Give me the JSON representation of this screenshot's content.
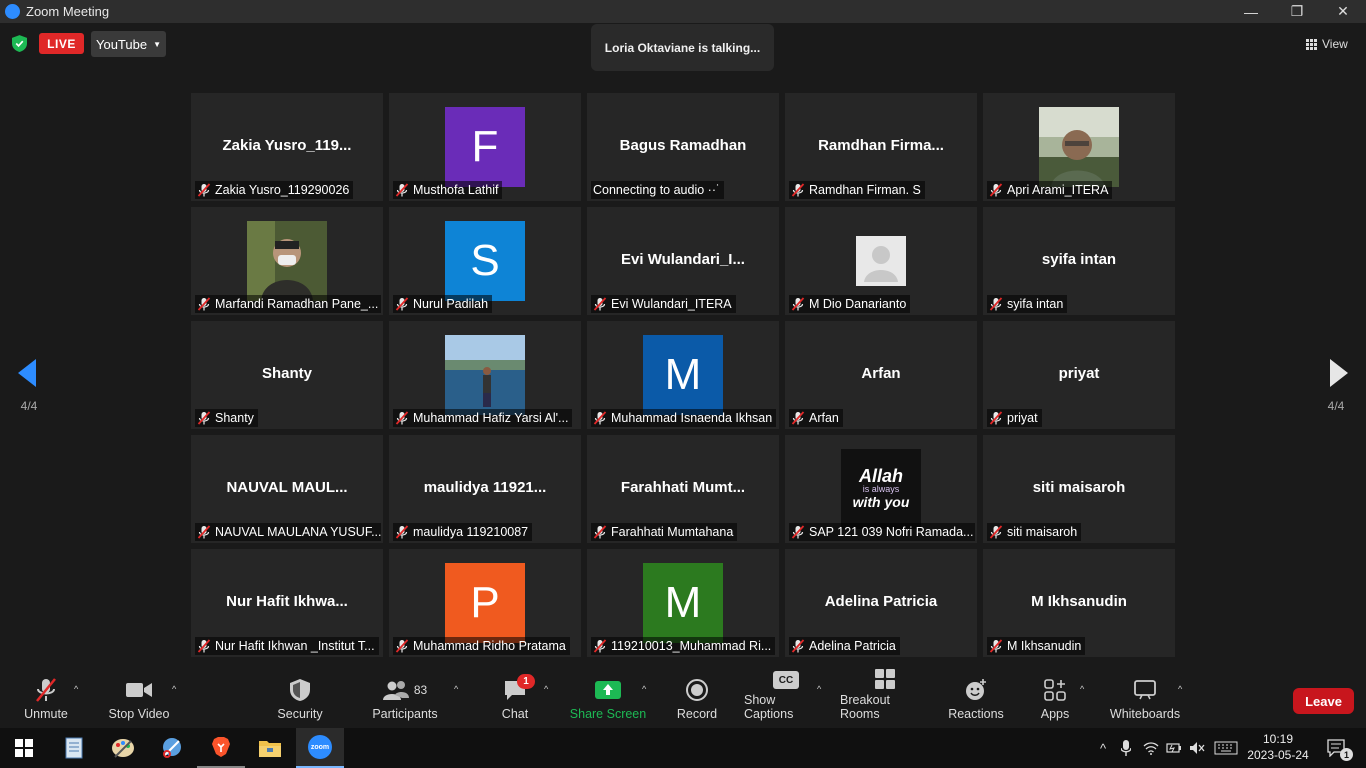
{
  "window": {
    "title": "Zoom Meeting"
  },
  "top": {
    "live_label": "LIVE",
    "stream_label": "YouTube",
    "talking": "Loria Oktaviane is talking...",
    "view_label": "View",
    "page_left": "4/4",
    "page_right": "4/4"
  },
  "tiles": [
    {
      "big": "Zakia  Yusro_119...",
      "name": "Zakia Yusro_119290026",
      "avatar": "",
      "muted": true
    },
    {
      "big": "",
      "name": "Musthofa Lathif",
      "avatar": "F",
      "avatar_color": "#6a2cb8",
      "muted": true
    },
    {
      "big": "Bagus Ramadhan",
      "name": "Connecting to audio ··˙",
      "avatar": "",
      "muted": false
    },
    {
      "big": "Ramdhan  Firma...",
      "name": "Ramdhan Firman. S",
      "avatar": "",
      "muted": true
    },
    {
      "big": "",
      "name": "Apri Arami_ITERA",
      "avatar": "photo",
      "photo": "man-glasses",
      "muted": true
    },
    {
      "big": "",
      "name": "Marfandi Ramadhan Pane_...",
      "avatar": "photo",
      "photo": "masked-man",
      "muted": true
    },
    {
      "big": "",
      "name": "Nurul Padilah",
      "avatar": "S",
      "avatar_color": "#0e84d6",
      "muted": true
    },
    {
      "big": "Evi  Wulandari_I...",
      "name": "Evi Wulandari_ITERA",
      "avatar": "",
      "muted": true
    },
    {
      "big": "",
      "name": "M Dio Danarianto",
      "avatar": "photo",
      "photo": "default-user",
      "muted": true
    },
    {
      "big": "syifa intan",
      "name": "syifa intan",
      "avatar": "",
      "muted": true
    },
    {
      "big": "Shanty",
      "name": "Shanty",
      "avatar": "",
      "muted": true
    },
    {
      "big": "",
      "name": "Muhammad Hafiz Yarsi Al'...",
      "avatar": "photo",
      "photo": "sea-man",
      "muted": true
    },
    {
      "big": "",
      "name": "Muhammad Isnaenda Ikhsan",
      "avatar": "M",
      "avatar_color": "#0b5aa8",
      "muted": true
    },
    {
      "big": "Arfan",
      "name": "Arfan",
      "avatar": "",
      "muted": true
    },
    {
      "big": "priyat",
      "name": "priyat",
      "avatar": "",
      "muted": true
    },
    {
      "big": "NAUVAL  MAUL...",
      "name": "NAUVAL MAULANA YUSUF...",
      "avatar": "",
      "muted": true
    },
    {
      "big": "maulidya  11921...",
      "name": "maulidya 119210087",
      "avatar": "",
      "muted": true
    },
    {
      "big": "Farahhati  Mumt...",
      "name": "Farahhati Mumtahana",
      "avatar": "",
      "muted": true
    },
    {
      "big": "",
      "name": "SAP 121 039 Nofri Ramada...",
      "avatar": "photo",
      "photo": "allah-text",
      "photo_text": [
        "Allah",
        "is always",
        "with you"
      ],
      "muted": true
    },
    {
      "big": "siti maisaroh",
      "name": "siti maisaroh",
      "avatar": "",
      "muted": true
    },
    {
      "big": "Nur  Hafit  Ikhwa...",
      "name": "Nur Hafit Ikhwan _Institut T...",
      "avatar": "",
      "muted": true
    },
    {
      "big": "",
      "name": "Muhammad Ridho Pratama",
      "avatar": "P",
      "avatar_color": "#f05a1f",
      "muted": true
    },
    {
      "big": "",
      "name": "119210013_Muhammad Ri...",
      "avatar": "M",
      "avatar_color": "#2c7a1f",
      "muted": true
    },
    {
      "big": "Adelina Patricia",
      "name": "Adelina Patricia",
      "avatar": "",
      "muted": true
    },
    {
      "big": "M Ikhsanudin",
      "name": "M Ikhsanudin",
      "avatar": "",
      "muted": true
    }
  ],
  "toolbar": {
    "unmute": "Unmute",
    "stop_video": "Stop Video",
    "security": "Security",
    "participants": "Participants",
    "participants_count": "83",
    "chat": "Chat",
    "chat_badge": "1",
    "share_screen": "Share Screen",
    "record": "Record",
    "captions": "Show Captions",
    "captions_icon_text": "CC",
    "breakout": "Breakout Rooms",
    "reactions": "Reactions",
    "apps": "Apps",
    "whiteboards": "Whiteboards",
    "leave": "Leave"
  },
  "taskbar": {
    "time": "10:19",
    "date": "2023-05-24",
    "notif_count": "1",
    "zoom_label": "zoom"
  },
  "colors": {
    "live": "#e02828",
    "leave": "#c8161d",
    "share_green": "#1db954",
    "nav_blue": "#2d8cff",
    "mute_red": "#e02828"
  }
}
